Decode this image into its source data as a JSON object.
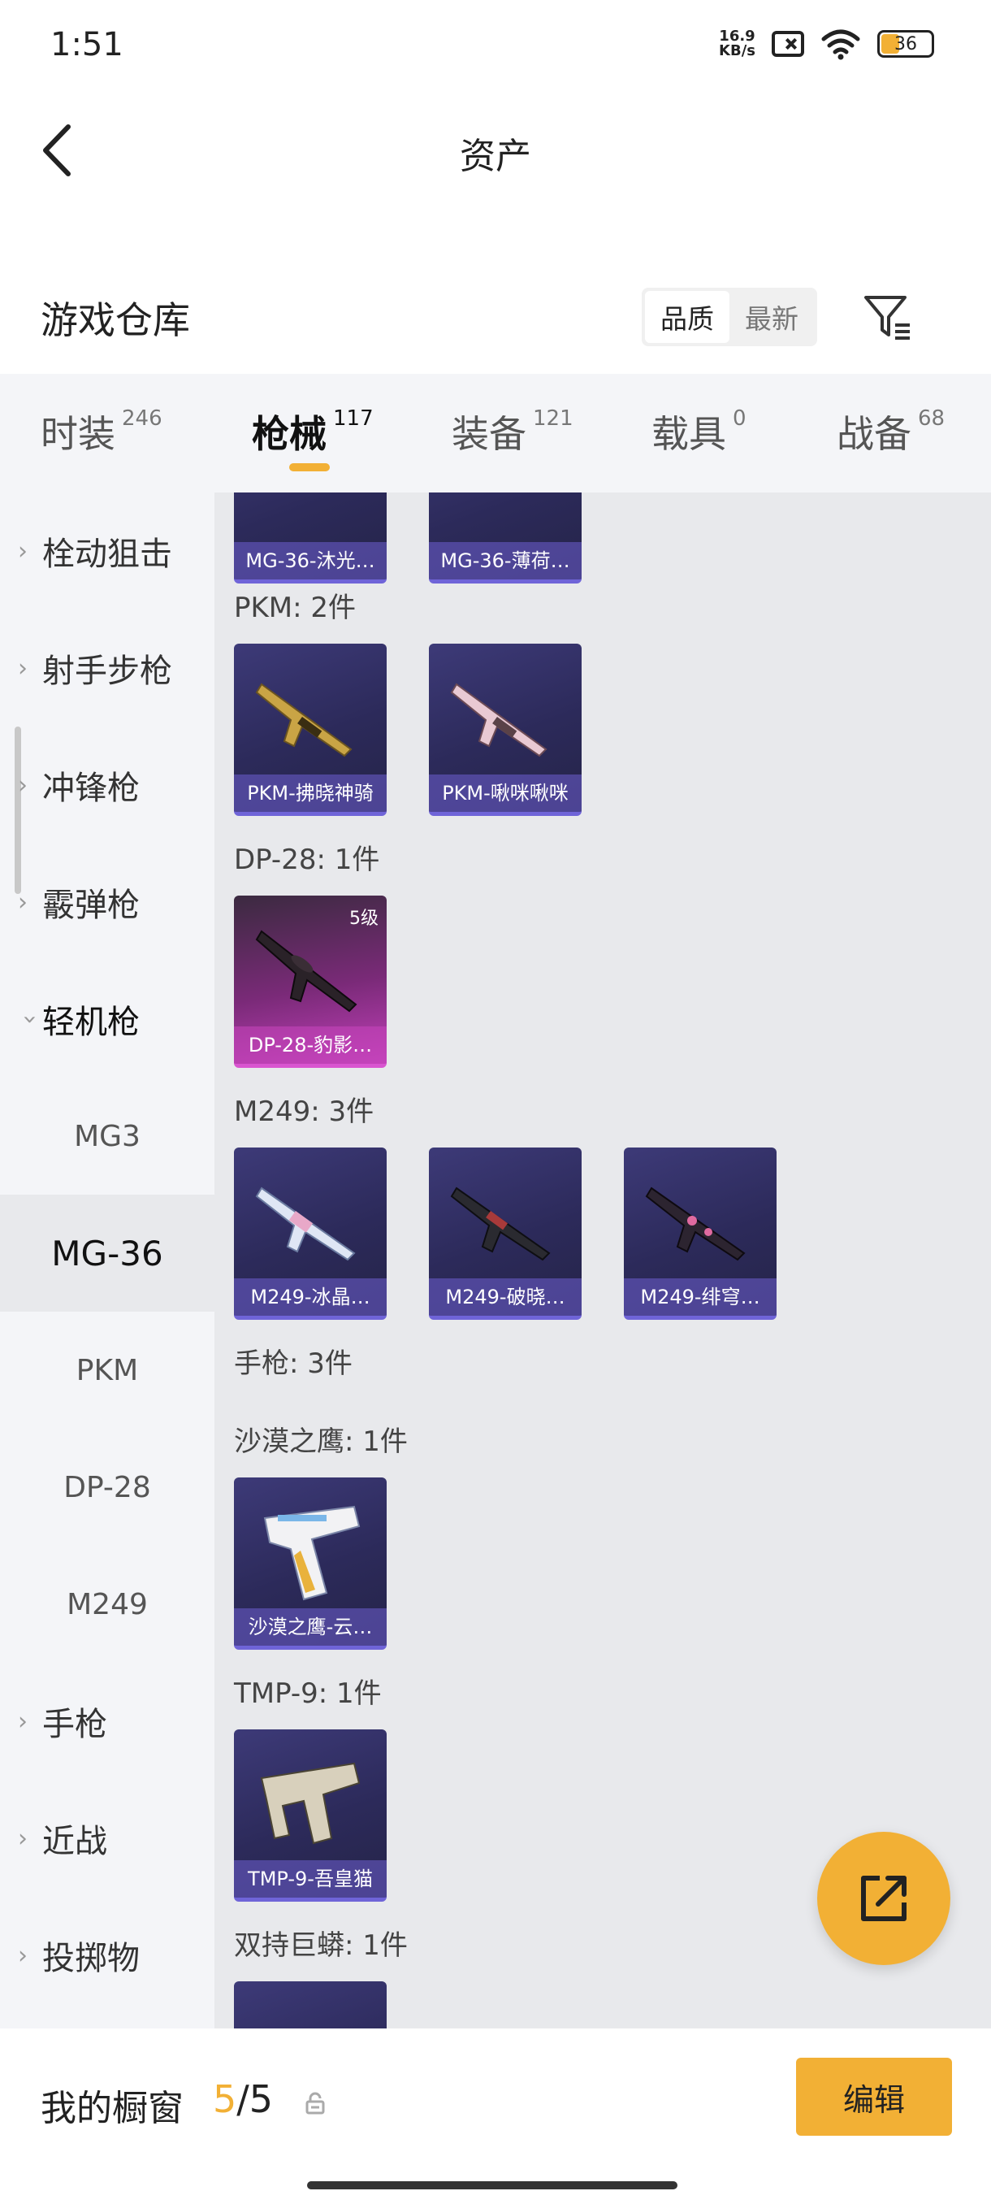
{
  "status_bar": {
    "time": "1:51",
    "net_speed_value": "16.9",
    "net_speed_unit": "KB/s",
    "battery": "36",
    "battery_level": 0.36
  },
  "header": {
    "title": "资产",
    "back_icon": "chevron-left-icon"
  },
  "warehouse": {
    "title": "游戏仓库",
    "sort_options": [
      "品质",
      "最新"
    ],
    "sort_selected": "品质",
    "filter_icon": "filter-icon"
  },
  "tabs": [
    {
      "label": "时装",
      "count": "246"
    },
    {
      "label": "枪械",
      "count": "117",
      "active": true
    },
    {
      "label": "装备",
      "count": "121"
    },
    {
      "label": "载具",
      "count": "0"
    },
    {
      "label": "战备",
      "count": "68"
    }
  ],
  "sidebar": {
    "categories": [
      {
        "label": "栓动狙击"
      },
      {
        "label": "射手步枪"
      },
      {
        "label": "冲锋枪"
      },
      {
        "label": "霰弹枪"
      },
      {
        "label": "轻机枪",
        "expanded": true
      }
    ],
    "subitems": [
      "MG3",
      "MG-36",
      "PKM",
      "DP-28",
      "M249"
    ],
    "active_subitem": "MG-36",
    "more_categories": [
      {
        "label": "手枪"
      },
      {
        "label": "近战"
      },
      {
        "label": "投掷物"
      }
    ]
  },
  "content": {
    "top_partial_cards": [
      "MG-36-沐光…",
      "MG-36-薄荷…"
    ],
    "groups": [
      {
        "label": "PKM: 2件",
        "cards": [
          "PKM-拂晓神骑",
          "PKM-啾咪啾咪"
        ]
      },
      {
        "label": "DP-28: 1件",
        "cards": [
          "DP-28-豹影…"
        ],
        "level": "5级"
      },
      {
        "label": "M249: 3件",
        "cards": [
          "M249-冰晶…",
          "M249-破晓…",
          "M249-绯穹…"
        ]
      },
      {
        "label": "手枪: 3件"
      },
      {
        "label": "沙漠之鹰: 1件",
        "cards": [
          "沙漠之鹰-云…"
        ]
      },
      {
        "label": "TMP-9: 1件",
        "cards": [
          "TMP-9-吾皇猫"
        ]
      },
      {
        "label": "双持巨蟒: 1件"
      }
    ],
    "fab_icon": "share-icon"
  },
  "bottom_bar": {
    "label": "我的橱窗",
    "current": "5",
    "separator": "/",
    "total": "5",
    "lock_icon": "lock-icon",
    "edit_label": "编辑"
  },
  "colors": {
    "accent": "#f2b035",
    "card_purple": "#3d3a78",
    "card_pink": "#c040b8"
  }
}
